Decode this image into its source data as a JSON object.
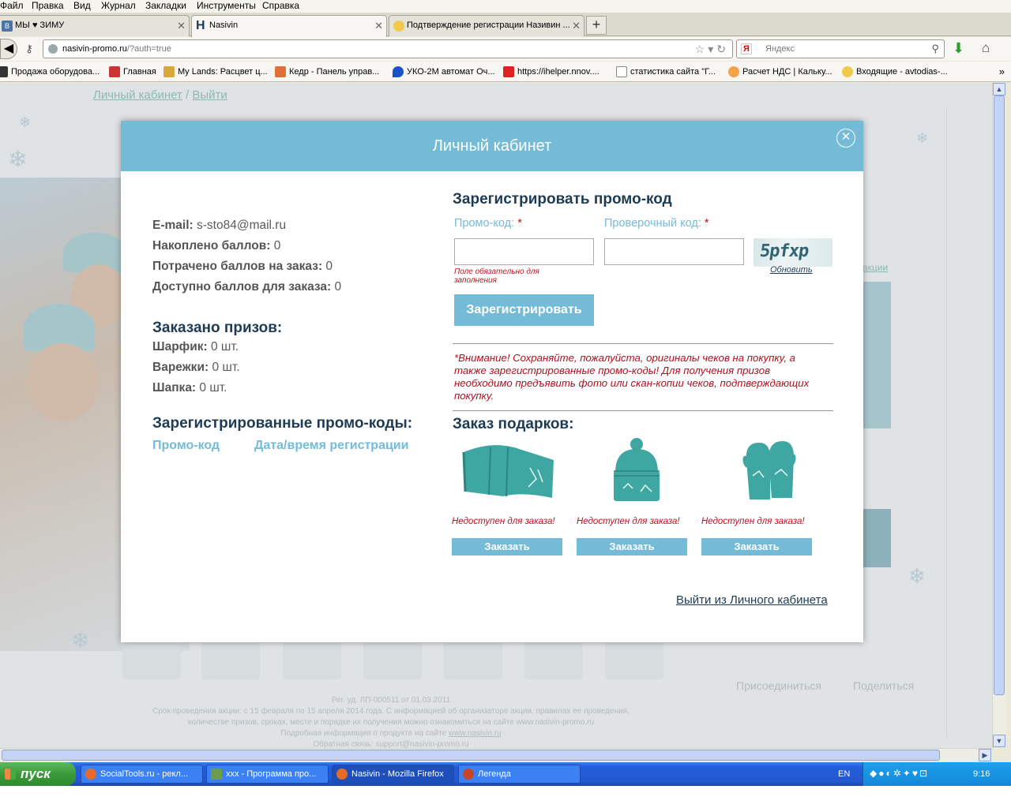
{
  "menubar": [
    "Файл",
    "Правка",
    "Вид",
    "Журнал",
    "Закладки",
    "Инструменты",
    "Справка"
  ],
  "tabs": [
    {
      "label": "МЫ ♥ ЗИМУ",
      "active": false
    },
    {
      "label": "Nasivin",
      "active": true
    },
    {
      "label": "Подтверждение регистрации Називин ...",
      "active": false
    }
  ],
  "urlbar": {
    "host": "nasivin-promo.ru",
    "path": "/?auth=true"
  },
  "search": {
    "placeholder": "Яндекс",
    "engine_logo": "Я"
  },
  "bookmarks": [
    "Продажа оборудова...",
    "Главная",
    "My Lands: Расцвет ц...",
    "Кедр - Панель управ...",
    "УКО-2М автомат Оч...",
    "https://ihelper.nnov....",
    "статистика сайта \"Г...",
    "Расчет НДС | Кальку...",
    "Входящие - avtodias-..."
  ],
  "background": {
    "login_link": "Личный кабинет",
    "separator": "/",
    "logout_link": "Выйти",
    "akcii": "акции",
    "footer_lines": [
      "Рег. уд. ЛП-000511 от 01.03.2011",
      "Срок проведения акции: с 15 февраля по 15 апреля 2014 года. С информацией об организаторе акции, правилах ее проведения,",
      "количестве призов, сроках, месте и порядке их получения можно ознакомиться на сайте www.nasivin-promo.ru",
      "Подробная информация о продукте на сайте",
      "Обратная связь: support@nasivin-promo.ru"
    ],
    "footer_link": "www.nasivin.ru",
    "join": "Присоединиться",
    "share": "Поделиться"
  },
  "modal": {
    "title": "Личный кабинет",
    "account": {
      "email_label": "E-mail:",
      "email": "s-sto84@mail.ru",
      "earned_label": "Накоплено баллов:",
      "earned": "0",
      "spent_label": "Потрачено баллов на заказ:",
      "spent": "0",
      "available_label": "Доступно баллов для заказа:",
      "available": "0"
    },
    "prizes": {
      "heading": "Заказано призов:",
      "items": [
        {
          "label": "Шарфик:",
          "value": "0 шт."
        },
        {
          "label": "Варежки:",
          "value": "0 шт."
        },
        {
          "label": "Шапка:",
          "value": "0 шт."
        }
      ]
    },
    "codes": {
      "heading": "Зарегистрированные промо-коды:",
      "col_code": "Промо-код",
      "col_date": "Дата/время регистрации"
    },
    "register": {
      "heading": "Зарегистрировать промо-код",
      "promo_label": "Промо-код:",
      "check_label": "Проверочный код:",
      "required_mark": "*",
      "promo_value": "",
      "check_value": "",
      "error": "Поле обязательно для заполнения",
      "captcha_text": "5pfxp",
      "refresh": "Обновить",
      "submit": "Зарегистрировать"
    },
    "warning": "*Внимание! Сохраняйте, пожалуйста, оригиналы чеков на покупку, а также зарегистрированные промо-коды! Для получения призов необходимо предъявить фото или скан-копии чеков, подтверждающих покупку.",
    "gifts": {
      "heading": "Заказ подарков:",
      "items": [
        {
          "name": "scarf",
          "status": "Недоступен для заказа!",
          "button": "Заказать"
        },
        {
          "name": "hat",
          "status": "Недоступен для заказа!",
          "button": "Заказать"
        },
        {
          "name": "mittens",
          "status": "Недоступен для заказа!",
          "button": "Заказать"
        }
      ]
    },
    "logout": "Выйти из Личного кабинета"
  },
  "taskbar": {
    "start": "пуск",
    "tasks": [
      {
        "label": "SocialTools.ru - рекл...",
        "active": false
      },
      {
        "label": "ххх - Программа про...",
        "active": false
      },
      {
        "label": "Nasivin - Mozilla Firefox",
        "active": true
      },
      {
        "label": "Легенда",
        "active": false
      }
    ],
    "lang": "EN",
    "time": "9:16"
  },
  "colors": {
    "accent": "#74bbd8",
    "heading": "#1d3b55",
    "error": "#c01020",
    "gift_teal": "#3fa7a2"
  }
}
